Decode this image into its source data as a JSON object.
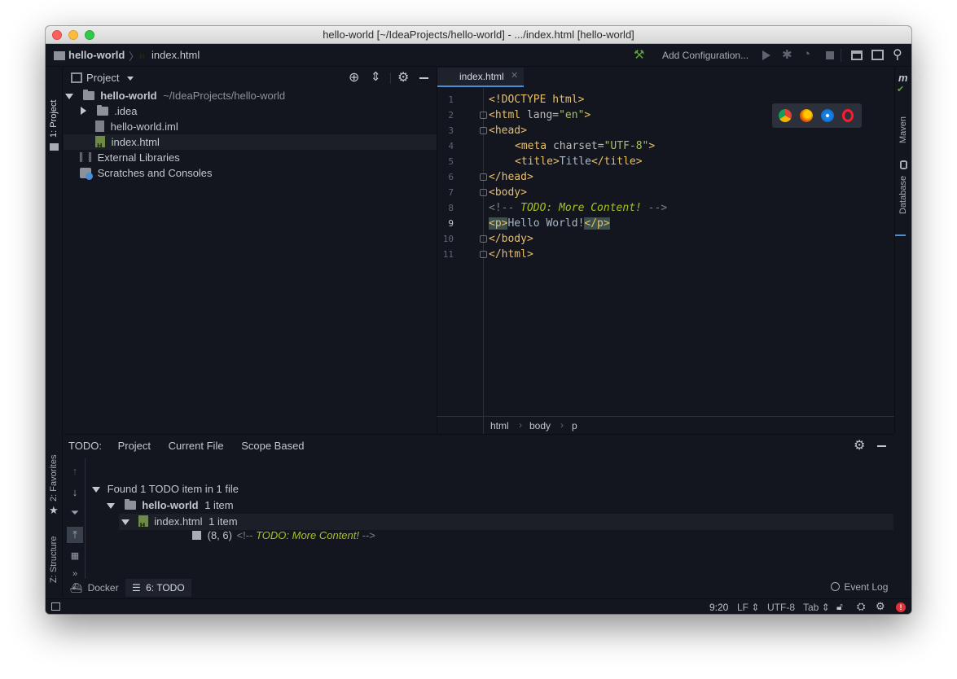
{
  "window": {
    "title": "hello-world [~/IdeaProjects/hello-world] - .../index.html [hello-world]"
  },
  "navbar": {
    "crumb_project": "hello-world",
    "crumb_file": "index.html",
    "add_configuration": "Add Configuration..."
  },
  "left_strip": {
    "project_tab": "1: Project",
    "favorites_tab": "2: Favorites",
    "structure_tab": "Z: Structure"
  },
  "project_panel": {
    "header": "Project",
    "root_name": "hello-world",
    "root_path": "~/IdeaProjects/hello-world",
    "items": [
      {
        "label": ".idea"
      },
      {
        "label": "hello-world.iml"
      },
      {
        "label": "index.html"
      }
    ],
    "external_libraries": "External Libraries",
    "scratches": "Scratches and Consoles"
  },
  "editor": {
    "tab_label": "index.html",
    "line_numbers": [
      "1",
      "2",
      "3",
      "4",
      "5",
      "6",
      "7",
      "8",
      "9",
      "10",
      "11"
    ],
    "code": {
      "l1": "<!DOCTYPE html>",
      "l2_open": "<html ",
      "l2_attr": "lang=",
      "l2_val": "\"en\"",
      "l2_close": ">",
      "l3": "<head>",
      "l4_open": "<meta ",
      "l4_attr": "charset=",
      "l4_val": "\"UTF-8\"",
      "l4_close": ">",
      "l5_open": "<title>",
      "l5_text": "Title",
      "l5_close": "</title>",
      "l6": "</head>",
      "l7": "<body>",
      "l8_open": "<!-- ",
      "l8_todo": "TODO: More Content!",
      "l8_close": " -->",
      "l9_open": "<p>",
      "l9_text": "Hello World!",
      "l9_close": "</p>",
      "l10": "</body>",
      "l11": "</html>"
    },
    "breadcrumbs": [
      "html",
      "body",
      "p"
    ]
  },
  "right_strip": {
    "maven": "Maven",
    "database": "Database"
  },
  "todo_panel": {
    "label": "TODO:",
    "tabs": [
      "Project",
      "Current File",
      "Scope Based"
    ],
    "summary": "Found 1 TODO item in 1 file",
    "project_name": "hello-world",
    "project_count": "1 item",
    "file_name": "index.html",
    "file_count": "1 item",
    "entry_pos": "(8, 6)",
    "entry_open": "<!-- ",
    "entry_todo": "TODO: More Content!",
    "entry_close": " -->"
  },
  "bottom_tabs": {
    "docker": "Docker",
    "todo": "6: TODO",
    "event_log": "Event Log"
  },
  "status": {
    "position": "9:20",
    "line_sep": "LF",
    "encoding": "UTF-8",
    "indent": "Tab"
  },
  "colors": {
    "background": "#13161e",
    "tag": "#e8bf6a",
    "string": "#a5c261",
    "todo": "#a8c023",
    "accent": "#4a8fd6"
  }
}
